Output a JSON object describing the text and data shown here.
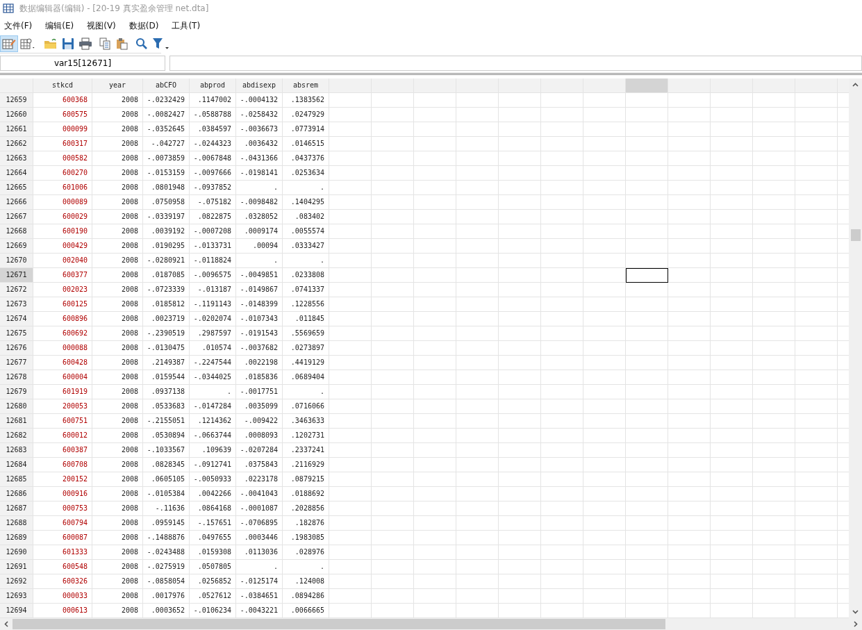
{
  "window": {
    "title": "数据编辑器(编辑) - [20-19 真实盈余管理 net.dta]"
  },
  "menu": [
    "文件(F)",
    "编辑(E)",
    "视图(V)",
    "数据(D)",
    "工具(T)"
  ],
  "toolbar": [
    {
      "kind": "edit-grid",
      "selected": true
    },
    {
      "kind": "browse-grid",
      "selected": false
    },
    {
      "kind": "open",
      "selected": false
    },
    {
      "kind": "save",
      "selected": false
    },
    {
      "kind": "print",
      "selected": false
    },
    {
      "kind": "copy",
      "selected": false
    },
    {
      "kind": "paste",
      "selected": false
    },
    {
      "kind": "search",
      "selected": false
    },
    {
      "kind": "filter",
      "selected": false
    }
  ],
  "cell_name": "var15[12671]",
  "columns": [
    "stkcd",
    "year",
    "abCFO",
    "abprod",
    "abdisexp",
    "absrem"
  ],
  "empty_columns": [
    {
      "selected": false
    },
    {
      "selected": false
    },
    {
      "selected": false
    },
    {
      "selected": false
    },
    {
      "selected": false
    },
    {
      "selected": false
    },
    {
      "selected": false
    },
    {
      "selected": true
    },
    {
      "selected": false
    },
    {
      "selected": false
    },
    {
      "selected": false
    },
    {
      "selected": false
    },
    {
      "selected": false
    }
  ],
  "rows": [
    {
      "row": "12659",
      "selected": false,
      "cells": [
        "600368",
        "2008",
        "-.0232429",
        ".1147002",
        "-.0004132",
        ".1383562"
      ]
    },
    {
      "row": "12660",
      "selected": false,
      "cells": [
        "600575",
        "2008",
        "-.0082427",
        "-.0588788",
        "-.0258432",
        ".0247929"
      ]
    },
    {
      "row": "12661",
      "selected": false,
      "cells": [
        "000099",
        "2008",
        "-.0352645",
        ".0384597",
        "-.0036673",
        ".0773914"
      ]
    },
    {
      "row": "12662",
      "selected": false,
      "cells": [
        "600317",
        "2008",
        "-.042727",
        "-.0244323",
        ".0036432",
        ".0146515"
      ]
    },
    {
      "row": "12663",
      "selected": false,
      "cells": [
        "000582",
        "2008",
        "-.0073859",
        "-.0067848",
        "-.0431366",
        ".0437376"
      ]
    },
    {
      "row": "12664",
      "selected": false,
      "cells": [
        "600270",
        "2008",
        "-.0153159",
        "-.0097666",
        "-.0198141",
        ".0253634"
      ]
    },
    {
      "row": "12665",
      "selected": false,
      "cells": [
        "601006",
        "2008",
        ".0801948",
        "-.0937852",
        ".",
        "."
      ]
    },
    {
      "row": "12666",
      "selected": false,
      "cells": [
        "000089",
        "2008",
        ".0750958",
        "-.075182",
        "-.0098482",
        ".1404295"
      ]
    },
    {
      "row": "12667",
      "selected": false,
      "cells": [
        "600029",
        "2008",
        "-.0339197",
        ".0822875",
        ".0328052",
        ".083402"
      ]
    },
    {
      "row": "12668",
      "selected": false,
      "cells": [
        "600190",
        "2008",
        ".0039192",
        "-.0007208",
        ".0009174",
        ".0055574"
      ]
    },
    {
      "row": "12669",
      "selected": false,
      "cells": [
        "000429",
        "2008",
        ".0190295",
        "-.0133731",
        ".00094",
        ".0333427"
      ]
    },
    {
      "row": "12670",
      "selected": false,
      "cells": [
        "002040",
        "2008",
        "-.0280921",
        "-.0118824",
        ".",
        "."
      ]
    },
    {
      "row": "12671",
      "selected": true,
      "cells": [
        "600377",
        "2008",
        ".0187085",
        "-.0096575",
        "-.0049851",
        ".0233808"
      ]
    },
    {
      "row": "12672",
      "selected": false,
      "cells": [
        "002023",
        "2008",
        "-.0723339",
        "-.013187",
        "-.0149867",
        ".0741337"
      ]
    },
    {
      "row": "12673",
      "selected": false,
      "cells": [
        "600125",
        "2008",
        ".0185812",
        "-.1191143",
        "-.0148399",
        ".1228556"
      ]
    },
    {
      "row": "12674",
      "selected": false,
      "cells": [
        "600896",
        "2008",
        ".0023719",
        "-.0202074",
        "-.0107343",
        ".011845"
      ]
    },
    {
      "row": "12675",
      "selected": false,
      "cells": [
        "600692",
        "2008",
        "-.2390519",
        ".2987597",
        "-.0191543",
        ".5569659"
      ]
    },
    {
      "row": "12676",
      "selected": false,
      "cells": [
        "000088",
        "2008",
        "-.0130475",
        ".010574",
        "-.0037682",
        ".0273897"
      ]
    },
    {
      "row": "12677",
      "selected": false,
      "cells": [
        "600428",
        "2008",
        ".2149387",
        "-.2247544",
        ".0022198",
        ".4419129"
      ]
    },
    {
      "row": "12678",
      "selected": false,
      "cells": [
        "600004",
        "2008",
        ".0159544",
        "-.0344025",
        ".0185836",
        ".0689404"
      ]
    },
    {
      "row": "12679",
      "selected": false,
      "cells": [
        "601919",
        "2008",
        ".0937138",
        ".",
        "-.0017751",
        "."
      ]
    },
    {
      "row": "12680",
      "selected": false,
      "cells": [
        "200053",
        "2008",
        ".0533683",
        "-.0147284",
        ".0035099",
        ".0716066"
      ]
    },
    {
      "row": "12681",
      "selected": false,
      "cells": [
        "600751",
        "2008",
        "-.2155051",
        ".1214362",
        "-.009422",
        ".3463633"
      ]
    },
    {
      "row": "12682",
      "selected": false,
      "cells": [
        "600012",
        "2008",
        ".0530894",
        "-.0663744",
        ".0008093",
        ".1202731"
      ]
    },
    {
      "row": "12683",
      "selected": false,
      "cells": [
        "600387",
        "2008",
        "-.1033567",
        ".109639",
        "-.0207284",
        ".2337241"
      ]
    },
    {
      "row": "12684",
      "selected": false,
      "cells": [
        "600708",
        "2008",
        ".0828345",
        "-.0912741",
        ".0375843",
        ".2116929"
      ]
    },
    {
      "row": "12685",
      "selected": false,
      "cells": [
        "200152",
        "2008",
        ".0605105",
        "-.0050933",
        ".0223178",
        ".0879215"
      ]
    },
    {
      "row": "12686",
      "selected": false,
      "cells": [
        "000916",
        "2008",
        "-.0105384",
        ".0042266",
        "-.0041043",
        ".0188692"
      ]
    },
    {
      "row": "12687",
      "selected": false,
      "cells": [
        "000753",
        "2008",
        "-.11636",
        ".0864168",
        "-.0001087",
        ".2028856"
      ]
    },
    {
      "row": "12688",
      "selected": false,
      "cells": [
        "600794",
        "2008",
        ".0959145",
        "-.157651",
        "-.0706895",
        ".182876"
      ]
    },
    {
      "row": "12689",
      "selected": false,
      "cells": [
        "600087",
        "2008",
        "-.1488876",
        ".0497655",
        ".0003446",
        ".1983085"
      ]
    },
    {
      "row": "12690",
      "selected": false,
      "cells": [
        "601333",
        "2008",
        "-.0243488",
        ".0159308",
        ".0113036",
        ".028976"
      ]
    },
    {
      "row": "12691",
      "selected": false,
      "cells": [
        "600548",
        "2008",
        "-.0275919",
        ".0507805",
        ".",
        "."
      ]
    },
    {
      "row": "12692",
      "selected": false,
      "cells": [
        "600326",
        "2008",
        "-.0858054",
        ".0256852",
        "-.0125174",
        ".124008"
      ]
    },
    {
      "row": "12693",
      "selected": false,
      "cells": [
        "000033",
        "2008",
        ".0017976",
        ".0527612",
        "-.0384651",
        ".0894286"
      ]
    },
    {
      "row": "12694",
      "selected": false,
      "cells": [
        "000613",
        "2008",
        ".0003652",
        "-.0106234",
        "-.0043221",
        ".0066665"
      ]
    }
  ]
}
